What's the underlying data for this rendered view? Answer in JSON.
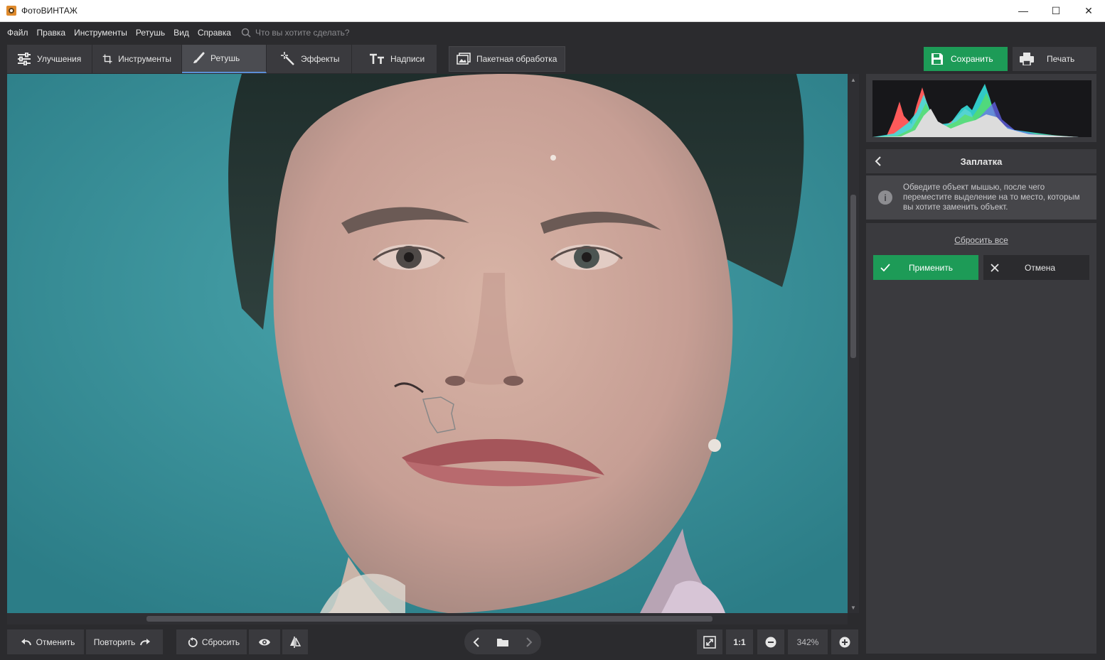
{
  "window": {
    "title": "ФотоВИНТАЖ",
    "minimize": "—",
    "maximize": "☐",
    "close": "✕"
  },
  "menu": {
    "items": [
      "Файл",
      "Правка",
      "Инструменты",
      "Ретушь",
      "Вид",
      "Справка"
    ],
    "search_placeholder": "Что вы хотите сделать?"
  },
  "toolbar": {
    "tabs": [
      {
        "label": "Улучшения",
        "icon": "sliders-icon"
      },
      {
        "label": "Инструменты",
        "icon": "crop-icon"
      },
      {
        "label": "Ретушь",
        "icon": "brush-icon",
        "active": true
      },
      {
        "label": "Эффекты",
        "icon": "magic-wand-icon"
      },
      {
        "label": "Надписи",
        "icon": "text-icon"
      }
    ],
    "batch_label": "Пакетная обработка",
    "save_label": "Сохранить",
    "print_label": "Печать"
  },
  "bottom": {
    "undo_label": "Отменить",
    "redo_label": "Повторить",
    "reset_label": "Сбросить",
    "one_to_one": "1:1",
    "zoom": "342%"
  },
  "panel": {
    "title": "Заплатка",
    "hint": "Обведите объект мышью, после чего переместите выделение на то место, которым вы хотите заменить объект.",
    "reset_all": "Сбросить все",
    "apply_label": "Применить",
    "cancel_label": "Отмена"
  },
  "colors": {
    "accent_green": "#1d9b57",
    "active_tab_border": "#5b8fd6",
    "background": "#2b2b2e"
  }
}
